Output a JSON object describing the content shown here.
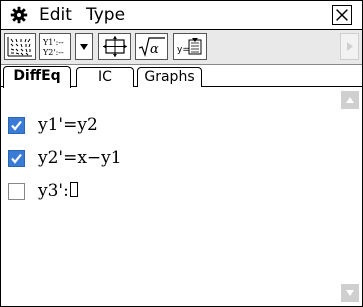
{
  "menubar": {
    "gear_icon": "gear-icon",
    "edit_label": "Edit",
    "type_label": "Type",
    "close_icon": "close-icon"
  },
  "toolbar": {
    "slope_field_icon": "slope-field-icon",
    "equation_list_icon": "equation-list-icon",
    "dropdown_icon": "chevron-down-icon",
    "view_window_icon": "view-window-icon",
    "sqrt_alpha_icon": "sqrt-alpha-icon",
    "graph_editor_icon": "graph-editor-icon",
    "right_scroll_icon": "chevron-right-icon"
  },
  "tabs": [
    {
      "label": "DiffEq",
      "active": true
    },
    {
      "label": "IC",
      "active": false
    },
    {
      "label": "Graphs",
      "active": false
    }
  ],
  "equations": [
    {
      "checked": true,
      "text": "y1'=y2"
    },
    {
      "checked": true,
      "text": "y2'=x−y1"
    },
    {
      "checked": false,
      "text": "y3':"
    }
  ],
  "colors": {
    "checkbox_checked": "#3a7bd5",
    "scroll_button": "#cfcfcf"
  }
}
